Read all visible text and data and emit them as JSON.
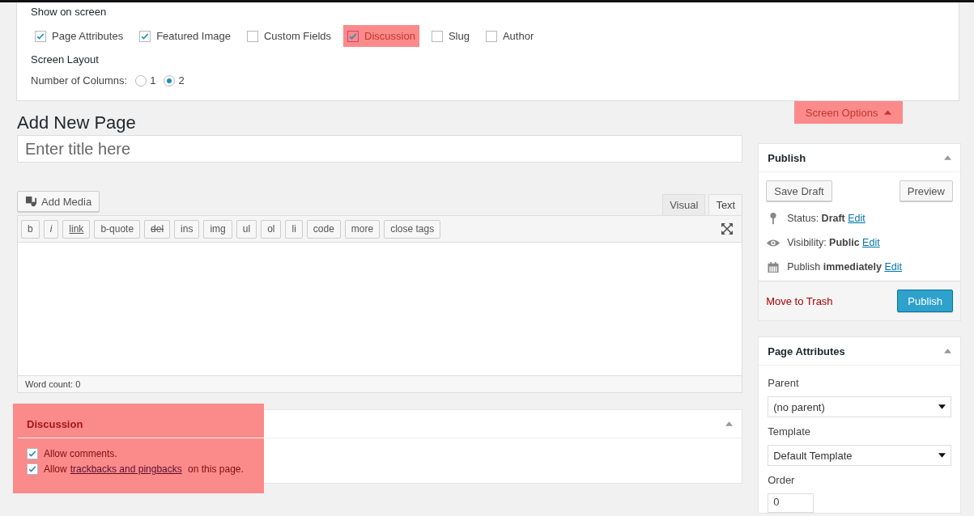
{
  "screen_options": {
    "show_heading": "Show on screen",
    "options": [
      {
        "label": "Page Attributes",
        "checked": true,
        "highlighted": false
      },
      {
        "label": "Featured Image",
        "checked": true,
        "highlighted": false
      },
      {
        "label": "Custom Fields",
        "checked": false,
        "highlighted": false
      },
      {
        "label": "Discussion",
        "checked": true,
        "highlighted": true
      },
      {
        "label": "Slug",
        "checked": false,
        "highlighted": false
      },
      {
        "label": "Author",
        "checked": false,
        "highlighted": false
      }
    ],
    "layout_heading": "Screen Layout",
    "columns_label": "Number of Columns:",
    "columns": [
      {
        "label": "1",
        "selected": false
      },
      {
        "label": "2",
        "selected": true
      }
    ]
  },
  "screen_options_toggle": {
    "label": "Screen Options",
    "highlighted": true
  },
  "page_title": "Add New Page",
  "title_field": {
    "placeholder": "Enter title here"
  },
  "add_media": "Add Media",
  "editor_tabs": [
    {
      "label": "Visual",
      "selected": false
    },
    {
      "label": "Text",
      "selected": true
    }
  ],
  "quicktags": [
    {
      "label": "b",
      "kind": "plain"
    },
    {
      "label": "i",
      "kind": "italic"
    },
    {
      "label": "link",
      "kind": "link"
    },
    {
      "label": "b-quote",
      "kind": "plain"
    },
    {
      "label": "del",
      "kind": "strike"
    },
    {
      "label": "ins",
      "kind": "plain"
    },
    {
      "label": "img",
      "kind": "plain"
    },
    {
      "label": "ul",
      "kind": "plain"
    },
    {
      "label": "ol",
      "kind": "plain"
    },
    {
      "label": "li",
      "kind": "plain"
    },
    {
      "label": "code",
      "kind": "plain"
    },
    {
      "label": "more",
      "kind": "plain"
    },
    {
      "label": "close tags",
      "kind": "plain"
    }
  ],
  "word_count": "Word count: 0",
  "discussion": {
    "title": "Discussion",
    "highlighted": true,
    "options": [
      {
        "text": "Allow comments.",
        "checked": true
      },
      {
        "text": "Allow",
        "link": "trackbacks and pingbacks",
        "after": "on this page.",
        "checked": true
      }
    ]
  },
  "publish": {
    "title": "Publish",
    "save_draft": "Save Draft",
    "preview": "Preview",
    "rows": [
      {
        "kind": "status",
        "text": "Status: **Draft**",
        "edit": "Edit"
      },
      {
        "kind": "visibility",
        "text": "Visibility: **Public**",
        "edit": "Edit"
      },
      {
        "kind": "schedule",
        "text": "Publish **immediately**",
        "edit": "Edit"
      }
    ],
    "trash": "Move to Trash",
    "publish_button": "Publish"
  },
  "page_attributes": {
    "title": "Page Attributes",
    "parent_label": "Parent",
    "parent_value": "(no parent)",
    "template_label": "Template",
    "template_value": "Default Template",
    "order_label": "Order",
    "order_value": "0"
  }
}
